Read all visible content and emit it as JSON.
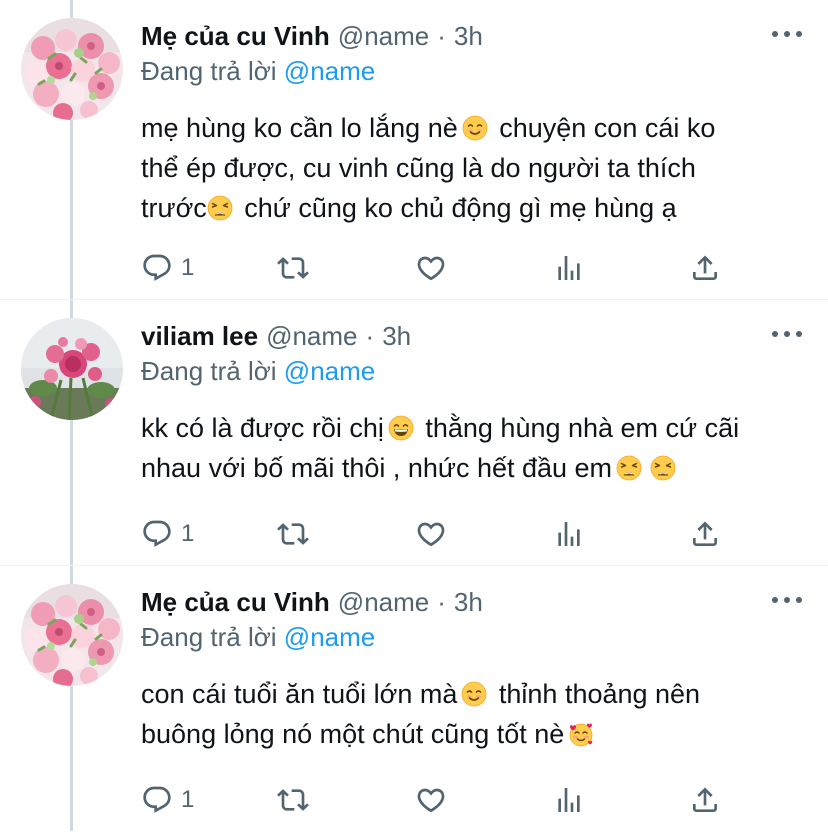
{
  "tweets": [
    {
      "author": "Mẹ của cu Vinh",
      "handle": "@name",
      "separator": "·",
      "time": "3h",
      "replying_prefix": "Đang trả lời",
      "replying_to": "@name",
      "text": {
        "line1a": "mẹ hùng ko cần lo lắng nè",
        "line1b": " chuyện con cái ko",
        "line2": "thể ép được, cu vinh cũng là do người ta thích",
        "line3a": "trước",
        "line3b": " chứ cũng ko chủ động gì mẹ hùng ạ"
      },
      "emojis": [
        "smiling-face-emoji",
        "weary-face-emoji"
      ],
      "reply_count": "1",
      "avatar": "pink-flower-bouquet"
    },
    {
      "author": "viliam lee",
      "handle": "@name",
      "separator": "·",
      "time": "3h",
      "replying_prefix": "Đang trả lời",
      "replying_to": "@name",
      "text": {
        "line1a": "kk có là được rồi chị",
        "line1b": " thằng hùng nhà em cứ cãi",
        "line2": "nhau với bố mãi thôi , nhức hết đầu em"
      },
      "emojis": [
        "grinning-face-emoji",
        "weary-face-emoji",
        "weary-face-emoji"
      ],
      "reply_count": "1",
      "avatar": "pink-roses-garden"
    },
    {
      "author": "Mẹ của cu Vinh",
      "handle": "@name",
      "separator": "·",
      "time": "3h",
      "replying_prefix": "Đang trả lời",
      "replying_to": "@name",
      "text": {
        "line1a": "con cái tuổi ăn tuổi lớn mà",
        "line1b": " thỉnh thoảng nên",
        "line2": "buông lỏng nó một chút cũng tốt nè"
      },
      "emojis": [
        "smiling-face-emoji",
        "smiling-face-with-hearts-emoji"
      ],
      "reply_count": "1",
      "avatar": "pink-flower-bouquet"
    }
  ],
  "icons": {
    "reply": "reply-icon",
    "retweet": "retweet-icon",
    "like": "heart-icon",
    "analytics": "analytics-icon",
    "share": "share-icon",
    "more": "more-icon"
  },
  "colors": {
    "text": "#0f1419",
    "secondary": "#536471",
    "link": "#1d9bf0",
    "thread_line": "#cfd9de"
  }
}
